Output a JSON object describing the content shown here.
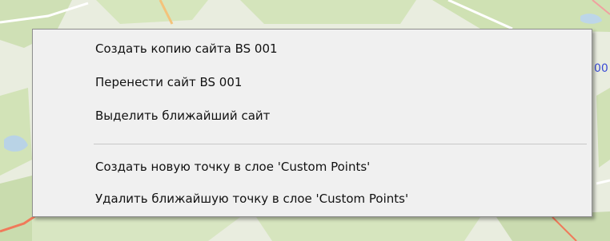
{
  "map": {
    "edge_label": "00"
  },
  "context_menu": {
    "items": [
      {
        "label": "Создать копию сайта BS 001"
      },
      {
        "label": "Перенести сайт BS 001"
      },
      {
        "label": "Выделить ближайший сайт"
      }
    ],
    "items_after_separator": [
      {
        "label": "Создать новую точку в слое 'Custom Points'"
      },
      {
        "label": "Удалить ближайшую точку в слое 'Custom Points'"
      }
    ]
  },
  "colors": {
    "menu_background": "#f0f0f0",
    "menu_border": "#8f8f8f",
    "hover_highlight": "#cce4f7",
    "map_label": "#3a4bd6"
  }
}
